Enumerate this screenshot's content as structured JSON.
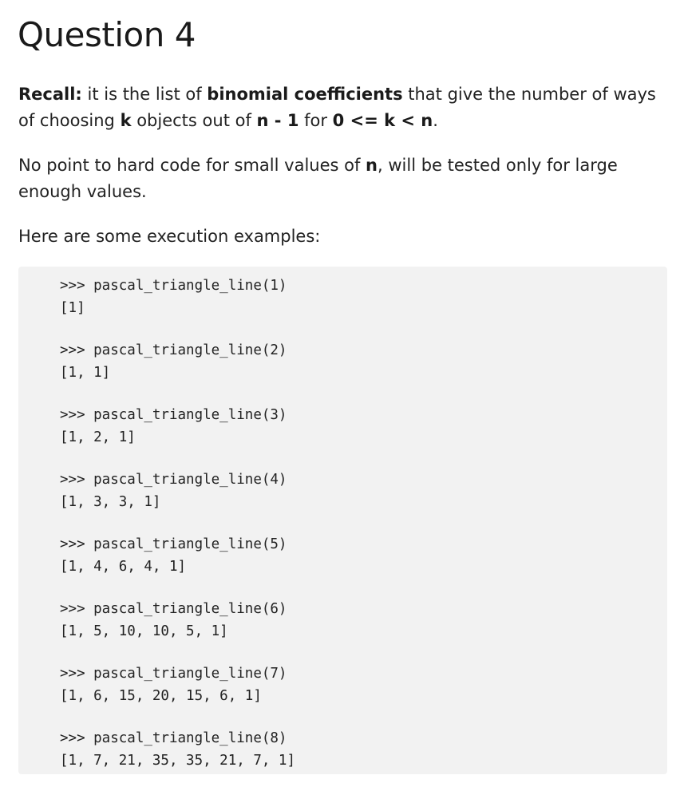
{
  "heading": "Question 4",
  "paragraph1": {
    "t1": "Recall:",
    "t2": " it is the list of ",
    "t3": "binomial coefficients",
    "t4": " that give the number of ways of choosing ",
    "t5": "k",
    "t6": " objects out of ",
    "t7": "n - 1",
    "t8": " for ",
    "t9": "0 <= k < n",
    "t10": "."
  },
  "paragraph2": {
    "t1": "No point to hard code for small values of ",
    "t2": "n",
    "t3": ", will be tested only for large enough values."
  },
  "paragraph3": "Here are some execution examples:",
  "examples": [
    {
      "call": ">>> pascal_triangle_line(1)",
      "result": "[1]"
    },
    {
      "call": ">>> pascal_triangle_line(2)",
      "result": "[1, 1]"
    },
    {
      "call": ">>> pascal_triangle_line(3)",
      "result": "[1, 2, 1]"
    },
    {
      "call": ">>> pascal_triangle_line(4)",
      "result": "[1, 3, 3, 1]"
    },
    {
      "call": ">>> pascal_triangle_line(5)",
      "result": "[1, 4, 6, 4, 1]"
    },
    {
      "call": ">>> pascal_triangle_line(6)",
      "result": "[1, 5, 10, 10, 5, 1]"
    },
    {
      "call": ">>> pascal_triangle_line(7)",
      "result": "[1, 6, 15, 20, 15, 6, 1]"
    },
    {
      "call": ">>> pascal_triangle_line(8)",
      "result": "[1, 7, 21, 35, 35, 21, 7, 1]"
    }
  ]
}
